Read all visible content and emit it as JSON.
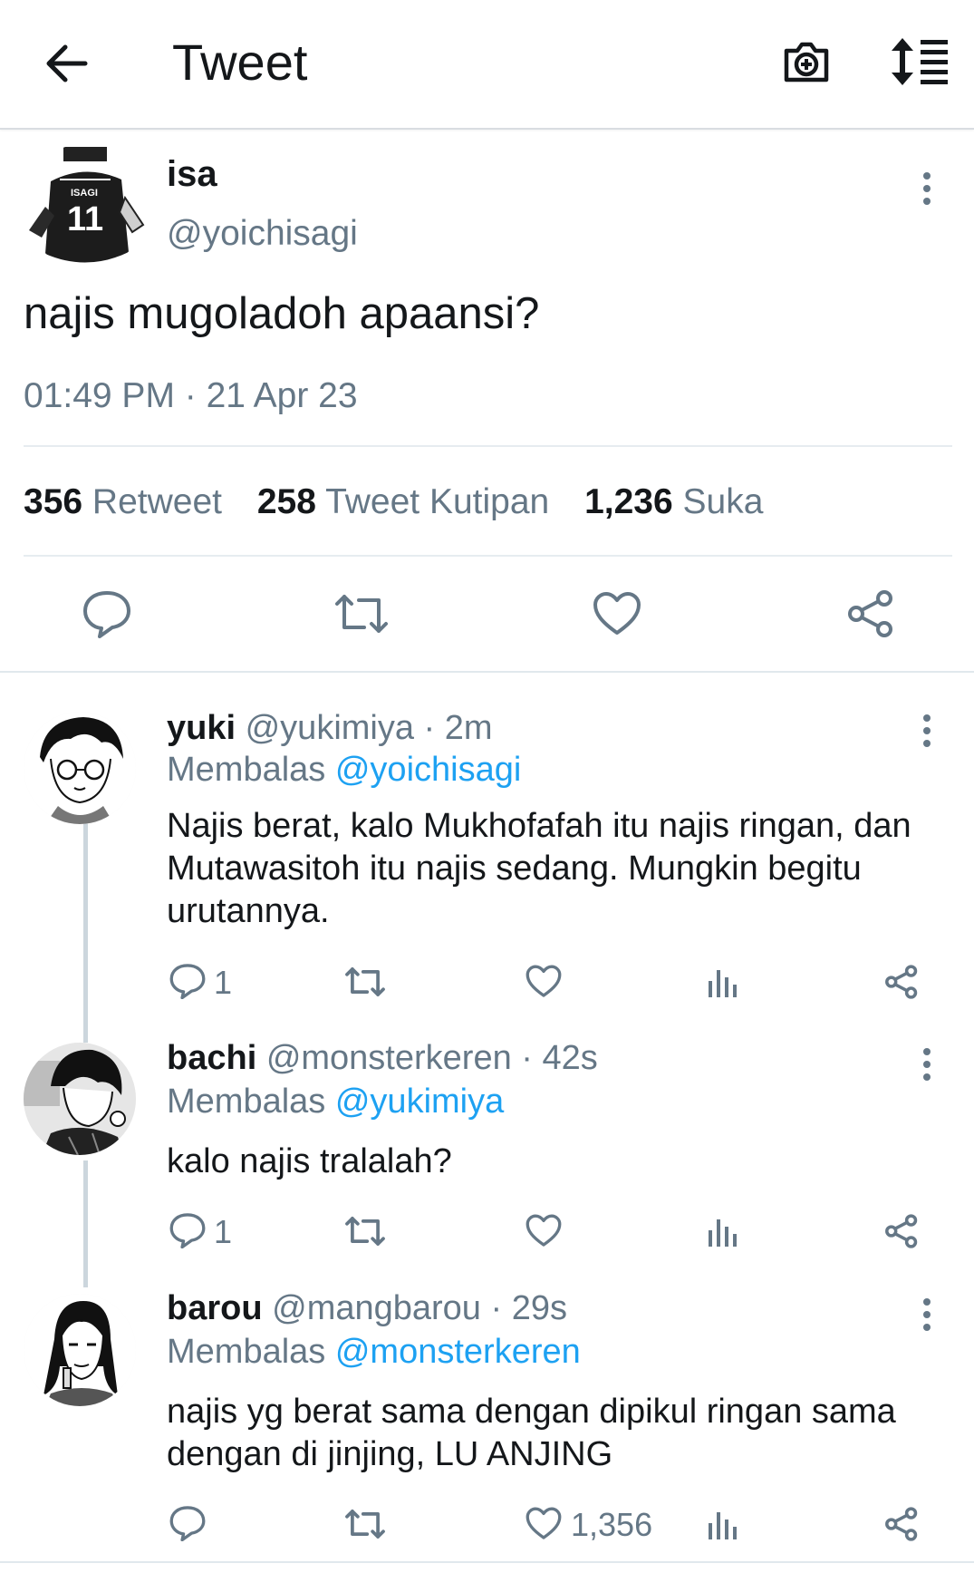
{
  "header": {
    "title": "Tweet",
    "back_icon": "arrow-left-icon",
    "camera_icon": "camera-plus-icon",
    "sort_icon": "sort-list-icon"
  },
  "main_tweet": {
    "name": "isa",
    "handle": "@yoichisagi",
    "text": "najis mugoladoh apaansi?",
    "time": "01:49 PM · 21 Apr 23",
    "avatar_jersey": "ISAGI",
    "avatar_number": "11",
    "stats": {
      "retweets": "356",
      "retweets_label": "Retweet",
      "quotes": "258",
      "quotes_label": "Tweet Kutipan",
      "likes": "1,236",
      "likes_label": "Suka"
    }
  },
  "replies": [
    {
      "name": "yuki",
      "meta": "@yukimiya · 2m",
      "replying_prefix": "Membalas",
      "replying_to": "@yoichisagi",
      "text": "Najis berat, kalo Mukhofafah itu najis ringan, dan Mutawasitoh itu najis sedang. Mungkin begitu urutannya.",
      "reply_count": "1",
      "like_count": ""
    },
    {
      "name": "bachi",
      "meta": "@monsterkeren · 42s",
      "replying_prefix": "Membalas",
      "replying_to": "@yukimiya",
      "text": "kalo najis tralalah?",
      "reply_count": "1",
      "like_count": ""
    },
    {
      "name": "barou",
      "meta": "@mangbarou · 29s",
      "replying_prefix": "Membalas",
      "replying_to": "@monsterkeren",
      "text": "najis yg berat sama dengan dipikul ringan sama dengan di jinjing, LU ANJING",
      "reply_count": "",
      "like_count": "1,356"
    }
  ],
  "colors": {
    "text": "#14171a",
    "secondary": "#657786",
    "link": "#1da1f2",
    "divider": "#e6ecf0"
  }
}
